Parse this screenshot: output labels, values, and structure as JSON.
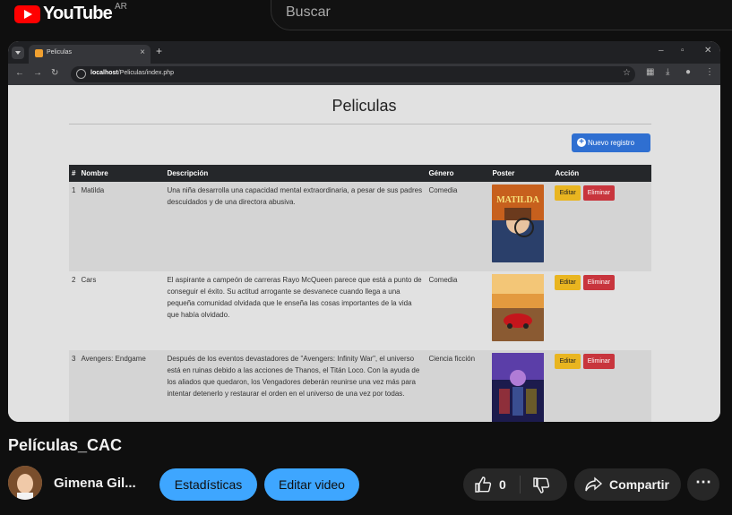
{
  "masthead": {
    "logo_text": "YouTube",
    "country_code": "AR",
    "search_placeholder": "Buscar"
  },
  "browser": {
    "tab_title": "Peliculas",
    "url_host": "localhost",
    "url_path": "/Peliculas/index.php"
  },
  "app": {
    "title": "Peliculas",
    "new_button": "Nuevo registro",
    "columns": [
      "#",
      "Nombre",
      "Descripción",
      "Género",
      "Poster",
      "Acción"
    ],
    "rows": [
      {
        "id": "1",
        "name": "Matilda",
        "description": "Una niña desarrolla una capacidad mental extraordinaria, a pesar de sus padres descuidados y de una directora abusiva.",
        "genre": "Comedia",
        "poster_text": "MATILDA"
      },
      {
        "id": "2",
        "name": "Cars",
        "description": "El aspirante a campeón de carreras Rayo McQueen parece que está a punto de conseguir el éxito. Su actitud arrogante se desvanece cuando llega a una pequeña comunidad olvidada que le enseña las cosas importantes de la vida que había olvidado.",
        "genre": "Comedia",
        "poster_text": ""
      },
      {
        "id": "3",
        "name": "Avengers: Endgame",
        "description": "Después de los eventos devastadores de \"Avengers: Infinity War\", el universo está en ruinas debido a las acciones de Thanos, el Titán Loco. Con la ayuda de los aliados que quedaron, los Vengadores deberán reunirse una vez más para intentar detenerlo y restaurar el orden en el universo de una vez por todas.",
        "genre": "Ciencia ficción",
        "poster_text": ""
      }
    ],
    "edit_label": "Editar",
    "delete_label": "Eliminar"
  },
  "video": {
    "title": "Películas_CAC",
    "channel": "Gimena Gil...",
    "stats_button": "Estadísticas",
    "edit_button": "Editar video",
    "likes": "0",
    "share_button": "Compartir"
  },
  "colors": {
    "accent_blue": "#3ea6ff",
    "yt_red": "#ff0000",
    "bootstrap_primary": "#2f6fd1",
    "warning": "#e9b520",
    "danger": "#c8353d"
  }
}
